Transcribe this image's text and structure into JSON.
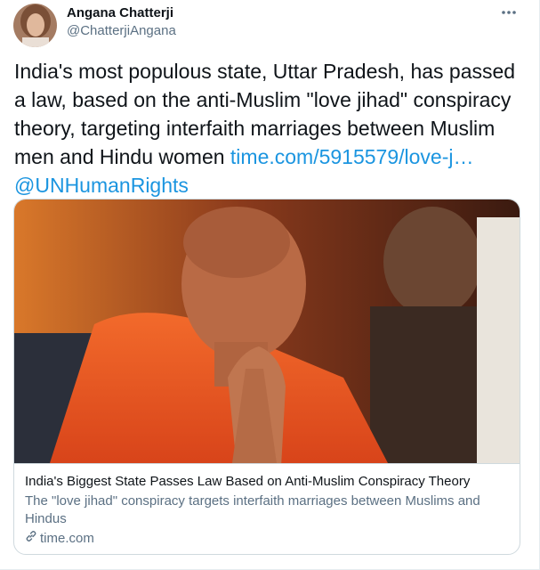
{
  "author": {
    "name": "Angana Chatterji",
    "handle": "@ChatterjiAngana"
  },
  "tweet": {
    "text": "India's most populous state, Uttar Pradesh, has passed a law, based on the anti-Muslim \"love jihad\" conspiracy theory, targeting interfaith marriages between Muslim men and Hindu women",
    "link": "time.com/5915579/love-j…",
    "mention": "@UNHumanRights"
  },
  "card": {
    "title": "India's Biggest State Passes Law Based on Anti-Muslim Conspiracy Theory",
    "description": "The \"love jihad\" conspiracy targets interfaith marriages between Muslims and Hindus",
    "domain": "time.com"
  },
  "colors": {
    "link": "#1b95e0",
    "secondary_text": "#5b7083",
    "border": "#cfd9de"
  },
  "icons": {
    "more": "more-icon",
    "link": "link-icon"
  }
}
